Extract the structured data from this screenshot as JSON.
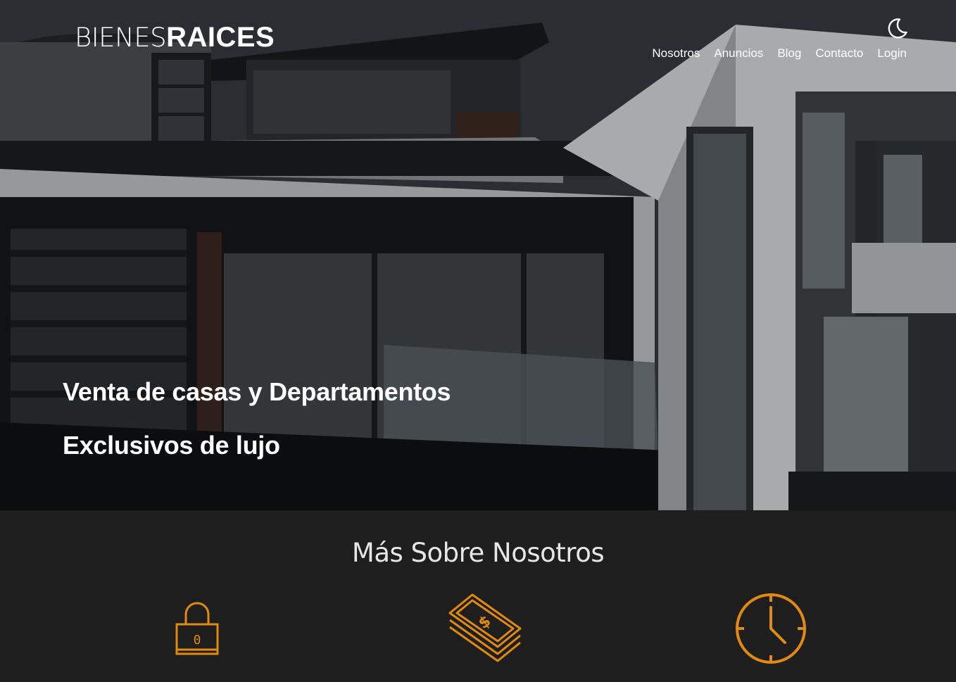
{
  "header": {
    "logo_light": "BIENES",
    "logo_bold": "RAICES",
    "theme_toggle_icon": "moon-icon"
  },
  "nav": {
    "items": [
      {
        "label": "Nosotros"
      },
      {
        "label": "Anuncios"
      },
      {
        "label": "Blog"
      },
      {
        "label": "Contacto"
      },
      {
        "label": "Login"
      }
    ]
  },
  "hero": {
    "title": "Venta de casas y Departamentos",
    "subtitle": "Exclusivos de lujo"
  },
  "about": {
    "heading": "Más Sobre Nosotros",
    "icons": [
      "lock-icon",
      "money-icon",
      "clock-icon"
    ]
  },
  "colors": {
    "accent": "#e08a10",
    "section_bg": "#1e1e1e",
    "text": "#ffffff"
  }
}
